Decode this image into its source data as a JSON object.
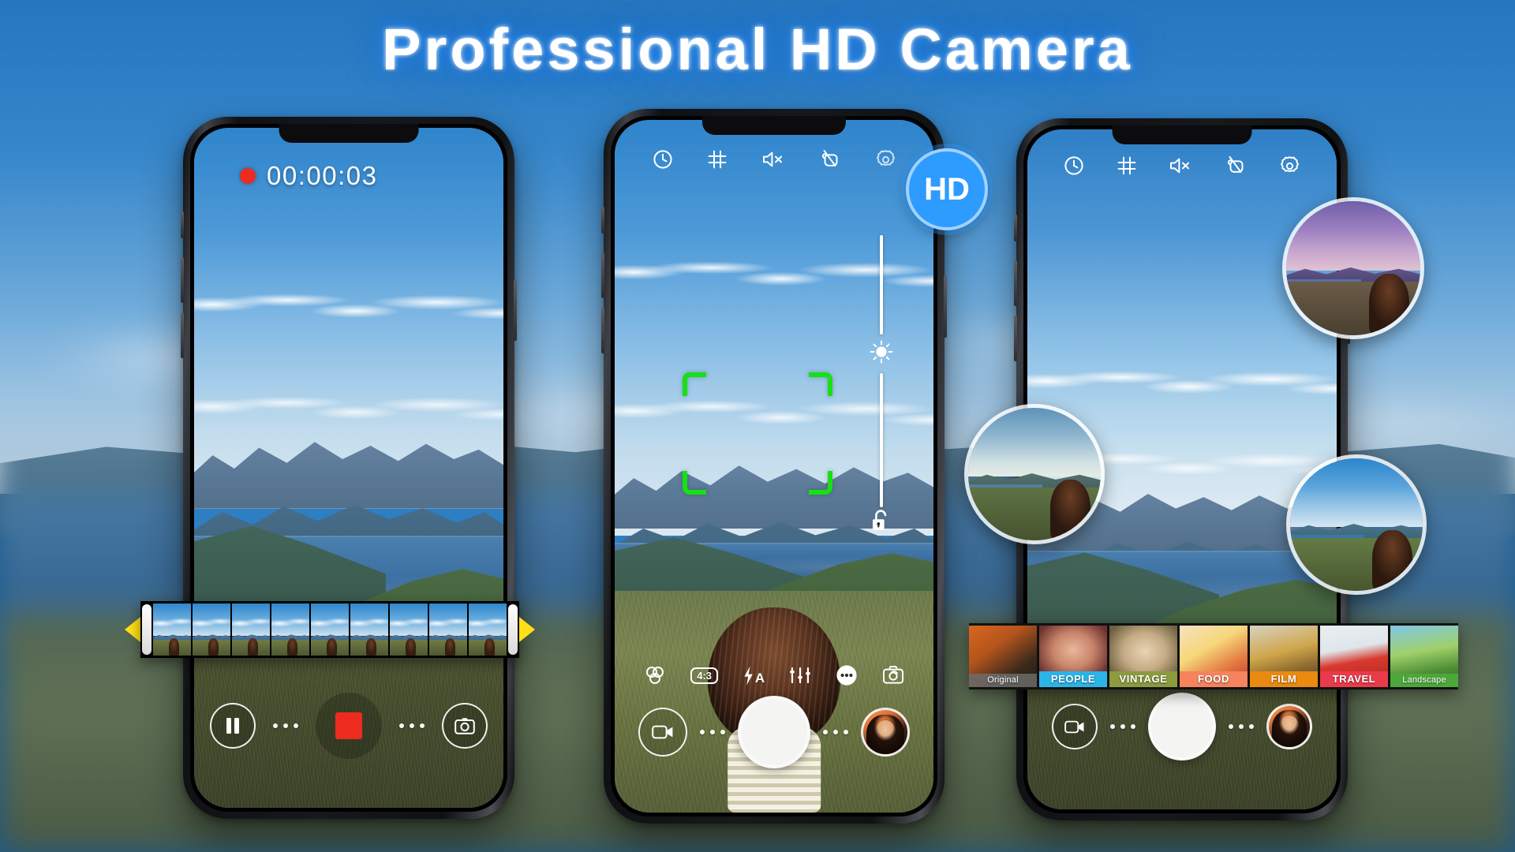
{
  "page": {
    "title": "Professional HD Camera",
    "accent_blue": "#2e9bff",
    "record_red": "#ee2b1f",
    "focus_green": "#17e015",
    "arrow_yellow": "#ffe018"
  },
  "phones": [
    {
      "id": "phone-video-recording",
      "recording": {
        "indicator": "record-dot",
        "timer": "00:00:03"
      },
      "timeline": {
        "left_arrow": "◀",
        "right_arrow": "▶",
        "frame_count": 10,
        "handle": "trim-handle"
      },
      "controls": [
        {
          "name": "pause-button",
          "icon": "pause-icon",
          "label": "Pause"
        },
        {
          "name": "stop-record-button",
          "icon": "stop-square-icon",
          "label": "Stop"
        },
        {
          "name": "capture-photo-button",
          "icon": "camera-icon",
          "label": "Photo"
        }
      ]
    },
    {
      "id": "phone-camera-viewfinder",
      "badge": {
        "name": "hd-badge",
        "label": "HD"
      },
      "top_icons": [
        {
          "name": "timer-icon",
          "label": "Timer"
        },
        {
          "name": "grid-icon",
          "label": "Grid"
        },
        {
          "name": "mute-icon",
          "label": "Mute"
        },
        {
          "name": "touch-shutter-icon",
          "label": "Touch shutter"
        },
        {
          "name": "settings-gear-icon",
          "label": "Settings"
        }
      ],
      "focus_frame": "focus-brackets",
      "exposure": {
        "name": "exposure-slider",
        "sun_icon": "sun-icon",
        "lock_icon": "unlock-icon"
      },
      "option_bar": [
        {
          "name": "filters-icon",
          "label": "Filters"
        },
        {
          "name": "aspect-ratio-button",
          "label": "4:3"
        },
        {
          "name": "flash-auto-icon",
          "label": "A"
        },
        {
          "name": "adjust-sliders-icon",
          "label": "Adjust"
        },
        {
          "name": "more-options-icon",
          "label": "More"
        },
        {
          "name": "switch-camera-icon",
          "label": "Switch"
        }
      ],
      "shutter_bar": [
        {
          "name": "video-mode-button",
          "icon": "video-camera-icon"
        },
        {
          "name": "shutter-button",
          "icon": "shutter-circle"
        },
        {
          "name": "gallery-thumbnail",
          "icon": "avatar"
        }
      ]
    },
    {
      "id": "phone-filters",
      "top_icons": [
        {
          "name": "timer-icon",
          "label": "Timer"
        },
        {
          "name": "grid-icon",
          "label": "Grid"
        },
        {
          "name": "mute-icon",
          "label": "Mute"
        },
        {
          "name": "touch-shutter-icon",
          "label": "Touch shutter"
        },
        {
          "name": "settings-gear-icon",
          "label": "Settings"
        }
      ],
      "preview_bubbles": [
        {
          "name": "filter-preview-purple",
          "tone": "#8d7ec4"
        },
        {
          "name": "filter-preview-warm",
          "tone": "#8fae86"
        },
        {
          "name": "filter-preview-cool",
          "tone": "#4f9ed2"
        }
      ],
      "filters": [
        {
          "label": "Original",
          "band_color": "#6f6f6f",
          "thumb_a": "#d8671f",
          "thumb_b": "#2b2016",
          "style": "small"
        },
        {
          "label": "PEOPLE",
          "band_color": "#2ab4e8",
          "thumb_a": "#e9b79c",
          "thumb_b": "#7a3a34",
          "style": "big"
        },
        {
          "label": "VINTAGE",
          "band_color": "#8b9b3e",
          "thumb_a": "#e2cfae",
          "thumb_b": "#6a5a3c",
          "style": "big"
        },
        {
          "label": "FOOD",
          "band_color": "#f5845e",
          "thumb_a": "#f6d77a",
          "thumb_b": "#c6402f",
          "style": "big"
        },
        {
          "label": "FILM",
          "band_color": "#ea8a10",
          "thumb_a": "#d9a13e",
          "thumb_b": "#2e4356",
          "style": "big"
        },
        {
          "label": "TRAVEL",
          "band_color": "#ea3b4a",
          "thumb_a": "#e7ecef",
          "thumb_b": "#cf2a2a",
          "style": "big"
        },
        {
          "label": "Landscape",
          "band_color": "#4ca83a",
          "thumb_a": "#7fc25a",
          "thumb_b": "#2f6a2b",
          "style": "small"
        }
      ],
      "shutter_bar": [
        {
          "name": "video-mode-button",
          "icon": "video-camera-icon"
        },
        {
          "name": "shutter-button",
          "icon": "shutter-circle"
        },
        {
          "name": "gallery-thumbnail",
          "icon": "avatar"
        }
      ]
    }
  ]
}
